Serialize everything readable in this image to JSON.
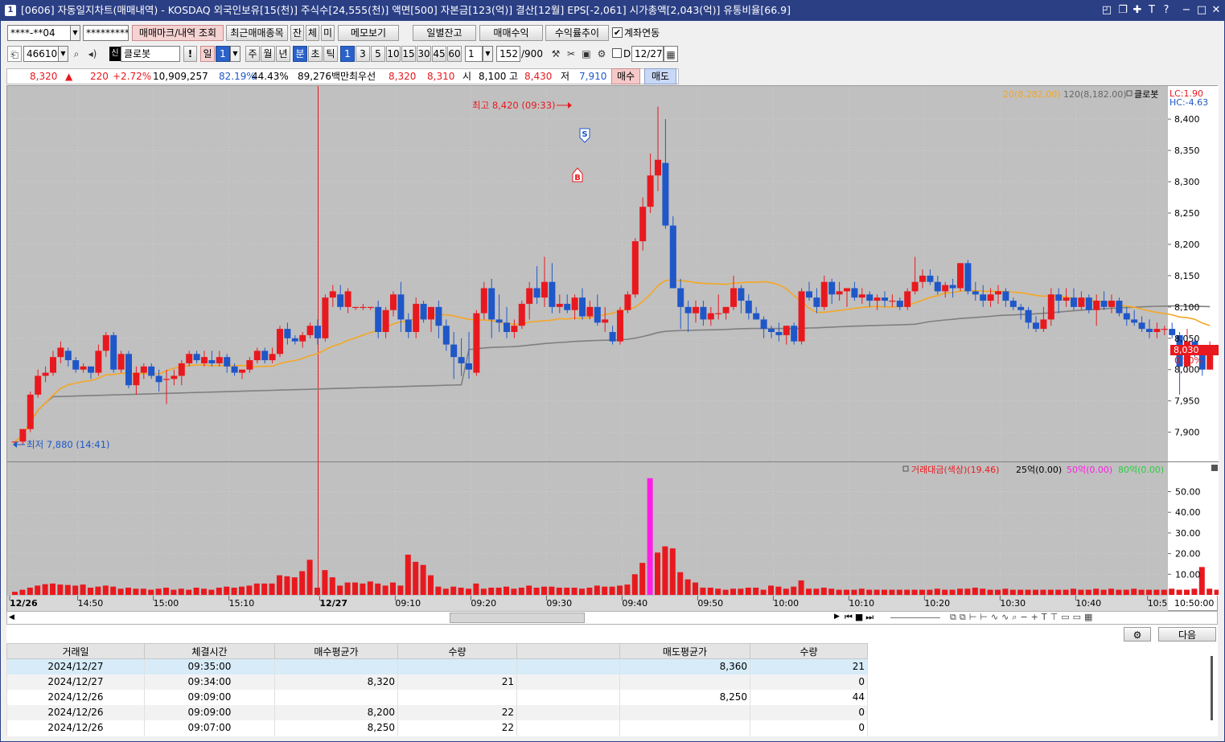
{
  "window": {
    "icon_label": "1",
    "title": "[0606] 자동일지차트(매매내역) - KOSDAQ 외국인보유[15(천)] 주식수[24,555(천)] 액면[500] 자본금[123(억)] 결산[12월] EPS[-2,061] 시가총액[2,043(억)] 유통비율[66.9]"
  },
  "toolbar1": {
    "account": "****-**04",
    "password": "*********",
    "btn_mark": "매매마크/내역 조회",
    "btn_recent": "최근매매종목",
    "btn_jan": "잔",
    "btn_che": "체",
    "btn_mi": "미",
    "btn_memo": "메모보기",
    "btn_daily": "일별잔고",
    "btn_profit": "매매수익",
    "btn_trend": "수익률추이",
    "link_label": "계좌연동",
    "link_checked": true
  },
  "toolbar2": {
    "code": "466100",
    "name": "클로봇",
    "name_badge": "신",
    "periods": [
      "일",
      "1",
      "주",
      "월",
      "년",
      "분",
      "초",
      "틱"
    ],
    "minutes": [
      "1",
      "3",
      "5",
      "10",
      "15",
      "30",
      "45",
      "60"
    ],
    "unit": "1",
    "count": "152",
    "count_max": "/900",
    "d_label": "D",
    "date": "12/27"
  },
  "quote": {
    "price": "8,320",
    "arrow": "▲",
    "change": "220",
    "pct": "+2.72%",
    "volume": "10,909,257",
    "vol_ratio": "82.19%",
    "vol_ratio2": "44.43%",
    "amount": "89,276백만",
    "best_label": "최우선",
    "best_ask": "8,320",
    "best_bid": "8,310",
    "open_label": "시",
    "open": "8,100",
    "high_label": "고",
    "high": "8,430",
    "low_label": "저",
    "low": "7,910",
    "buy_btn": "매수",
    "sell_btn": "매도"
  },
  "chart": {
    "legend_ma20": "20(8,282.00)",
    "legend_ma120": "120(8,182.00)",
    "legend_name": "클로봇",
    "lc": "LC:1.90",
    "hc": "HC:-4.63",
    "price_ticks": [
      "8,400",
      "8,350",
      "8,300",
      "8,250",
      "8,200",
      "8,150",
      "8,100",
      "8,050",
      "8,000",
      "7,950",
      "7,900"
    ],
    "current_price": "8,030",
    "current_pct": "0.50%",
    "high_note": "최고 8,420 (09:33)",
    "low_note": "최저 7,880 (14:41)",
    "marker_s": "S",
    "marker_b": "B",
    "vol_legend": {
      "name": "거래대금(색상)(19.46)",
      "l1": "25억(0.00)",
      "l2": "50억(0.00)",
      "l3": "80억(0.00)"
    },
    "vol_ticks": [
      "50.00",
      "40.00",
      "30.00",
      "20.00",
      "10.00"
    ],
    "time_labels": [
      "12/26",
      "14:50",
      "15:00",
      "15:10",
      "12/27",
      "09:10",
      "09:20",
      "09:30",
      "09:40",
      "09:50",
      "10:00",
      "10:10",
      "10:20",
      "10:30",
      "10:40",
      "10:5"
    ],
    "time_right": "10:50:00",
    "colors": {
      "up": "#e8191e",
      "down": "#1f57c8",
      "ma20": "#f5a623",
      "ma120": "#7f7f7f",
      "highlight": "#ff1ee6"
    }
  },
  "chart_data": {
    "type": "candlestick",
    "title": "",
    "price_axis": {
      "min": 7870,
      "max": 8440
    },
    "volume_axis": {
      "min": 0,
      "max": 58
    },
    "current_price": 8030,
    "candles": [
      [
        7885,
        7885,
        7880,
        7885
      ],
      [
        7885,
        7905,
        7880,
        7905
      ],
      [
        7905,
        7965,
        7900,
        7960
      ],
      [
        7960,
        8000,
        7955,
        7990
      ],
      [
        7990,
        8005,
        7980,
        7995
      ],
      [
        7995,
        8030,
        7990,
        8020
      ],
      [
        8020,
        8045,
        8010,
        8035
      ],
      [
        8030,
        8035,
        8005,
        8015
      ],
      [
        8015,
        8020,
        7995,
        8000
      ],
      [
        8000,
        8010,
        7995,
        8005
      ],
      [
        8005,
        8005,
        7985,
        7995
      ],
      [
        7995,
        8040,
        7990,
        8030
      ],
      [
        8030,
        8060,
        8020,
        8055
      ],
      [
        8055,
        8060,
        7995,
        8000
      ],
      [
        8000,
        8030,
        7995,
        8025
      ],
      [
        8025,
        8030,
        7970,
        7975
      ],
      [
        7975,
        8005,
        7960,
        7995
      ],
      [
        7995,
        8010,
        7985,
        8005
      ],
      [
        8005,
        8010,
        7985,
        7990
      ],
      [
        7990,
        8000,
        7965,
        7980
      ],
      [
        7985,
        8000,
        7945,
        7985
      ],
      [
        7985,
        8000,
        7975,
        7990
      ],
      [
        7990,
        8015,
        7975,
        8010
      ],
      [
        8010,
        8030,
        8005,
        8025
      ],
      [
        8025,
        8030,
        8010,
        8015
      ],
      [
        8010,
        8030,
        8005,
        8020
      ],
      [
        8015,
        8030,
        8005,
        8010
      ],
      [
        8010,
        8030,
        8005,
        8020
      ],
      [
        8020,
        8025,
        7995,
        8005
      ],
      [
        8005,
        8010,
        7990,
        7995
      ],
      [
        7995,
        8000,
        7985,
        8000
      ],
      [
        8000,
        8020,
        7995,
        8015
      ],
      [
        8015,
        8035,
        8010,
        8030
      ],
      [
        8030,
        8035,
        8010,
        8015
      ],
      [
        8015,
        8035,
        8010,
        8025
      ],
      [
        8025,
        8070,
        8020,
        8065
      ],
      [
        8065,
        8075,
        8040,
        8050
      ],
      [
        8050,
        8055,
        8040,
        8045
      ],
      [
        8045,
        8060,
        8035,
        8055
      ],
      [
        8055,
        8075,
        8050,
        8070
      ],
      [
        8070,
        8080,
        8040,
        8050
      ],
      [
        8050,
        8120,
        8045,
        8115
      ],
      [
        8115,
        8135,
        8100,
        8125
      ],
      [
        8120,
        8135,
        8095,
        8100
      ],
      [
        8100,
        8130,
        8090,
        8125
      ],
      [
        8100,
        8100,
        8095,
        8100
      ],
      [
        8100,
        8105,
        8095,
        8100
      ],
      [
        8100,
        8100,
        8095,
        8100
      ],
      [
        8100,
        8110,
        8050,
        8060
      ],
      [
        8060,
        8100,
        8050,
        8095
      ],
      [
        8095,
        8125,
        8085,
        8120
      ],
      [
        8120,
        8140,
        8060,
        8080
      ],
      [
        8080,
        8090,
        8050,
        8060
      ],
      [
        8060,
        8115,
        8050,
        8105
      ],
      [
        8105,
        8110,
        8075,
        8080
      ],
      [
        8080,
        8100,
        8060,
        8100
      ],
      [
        8100,
        8110,
        8050,
        8070
      ],
      [
        8070,
        8080,
        8030,
        8040
      ],
      [
        8040,
        8060,
        7985,
        8020
      ],
      [
        8020,
        8050,
        7990,
        8010
      ],
      [
        8010,
        8060,
        7985,
        8000
      ],
      [
        7995,
        8095,
        7990,
        8090
      ],
      [
        8090,
        8140,
        8080,
        8130
      ],
      [
        8130,
        8145,
        8050,
        8080
      ],
      [
        8080,
        8120,
        8060,
        8075
      ],
      [
        8075,
        8100,
        8050,
        8060
      ],
      [
        8060,
        8080,
        8050,
        8070
      ],
      [
        8070,
        8110,
        8065,
        8105
      ],
      [
        8105,
        8140,
        8080,
        8130
      ],
      [
        8130,
        8165,
        8105,
        8115
      ],
      [
        8115,
        8180,
        8100,
        8140
      ],
      [
        8140,
        8170,
        8090,
        8100
      ],
      [
        8100,
        8120,
        8090,
        8105
      ],
      [
        8105,
        8120,
        8090,
        8095
      ],
      [
        8095,
        8120,
        8080,
        8115
      ],
      [
        8115,
        8130,
        8080,
        8085
      ],
      [
        8085,
        8110,
        8080,
        8100
      ],
      [
        8100,
        8120,
        8070,
        8075
      ],
      [
        8075,
        8100,
        8060,
        8080
      ],
      [
        8060,
        8070,
        8040,
        8045
      ],
      [
        8045,
        8100,
        8040,
        8095
      ],
      [
        8095,
        8125,
        8090,
        8120
      ],
      [
        8120,
        8210,
        8115,
        8205
      ],
      [
        8205,
        8275,
        8190,
        8260
      ],
      [
        8260,
        8345,
        8250,
        8310
      ],
      [
        8310,
        8420,
        8285,
        8335
      ],
      [
        8330,
        8400,
        8225,
        8230
      ],
      [
        8230,
        8245,
        8130,
        8130
      ],
      [
        8130,
        8145,
        8065,
        8100
      ],
      [
        8100,
        8110,
        8060,
        8090
      ],
      [
        8090,
        8110,
        8075,
        8100
      ],
      [
        8100,
        8110,
        8070,
        8080
      ],
      [
        8080,
        8100,
        8070,
        8090
      ],
      [
        8090,
        8120,
        8080,
        8090
      ],
      [
        8090,
        8100,
        8080,
        8100
      ],
      [
        8100,
        8150,
        8095,
        8130
      ],
      [
        8130,
        8135,
        8090,
        8110
      ],
      [
        8110,
        8120,
        8080,
        8090
      ],
      [
        8090,
        8100,
        8080,
        8080
      ],
      [
        8080,
        8085,
        8050,
        8065
      ],
      [
        8065,
        8070,
        8050,
        8060
      ],
      [
        8060,
        8075,
        8045,
        8055
      ],
      [
        8055,
        8070,
        8040,
        8070
      ],
      [
        8070,
        8075,
        8040,
        8045
      ],
      [
        8045,
        8130,
        8040,
        8125
      ],
      [
        8125,
        8140,
        8110,
        8115
      ],
      [
        8115,
        8130,
        8090,
        8100
      ],
      [
        8100,
        8150,
        8095,
        8140
      ],
      [
        8140,
        8145,
        8105,
        8120
      ],
      [
        8120,
        8140,
        8110,
        8125
      ],
      [
        8125,
        8130,
        8100,
        8130
      ],
      [
        8130,
        8140,
        8110,
        8115
      ],
      [
        8115,
        8130,
        8105,
        8120
      ],
      [
        8120,
        8125,
        8100,
        8110
      ],
      [
        8110,
        8120,
        8095,
        8115
      ],
      [
        8115,
        8125,
        8100,
        8110
      ],
      [
        8110,
        8120,
        8100,
        8110
      ],
      [
        8110,
        8115,
        8095,
        8100
      ],
      [
        8100,
        8130,
        8095,
        8125
      ],
      [
        8125,
        8180,
        8120,
        8140
      ],
      [
        8140,
        8160,
        8130,
        8150
      ],
      [
        8150,
        8160,
        8135,
        8140
      ],
      [
        8140,
        8150,
        8120,
        8125
      ],
      [
        8125,
        8140,
        8115,
        8135
      ],
      [
        8135,
        8145,
        8115,
        8130
      ],
      [
        8130,
        8170,
        8125,
        8170
      ],
      [
        8170,
        8175,
        8120,
        8125
      ],
      [
        8125,
        8140,
        8110,
        8120
      ],
      [
        8120,
        8135,
        8100,
        8110
      ],
      [
        8110,
        8130,
        8100,
        8120
      ],
      [
        8120,
        8135,
        8105,
        8125
      ],
      [
        8125,
        8130,
        8100,
        8110
      ],
      [
        8110,
        8115,
        8095,
        8100
      ],
      [
        8100,
        8105,
        8080,
        8095
      ],
      [
        8095,
        8100,
        8065,
        8075
      ],
      [
        8075,
        8085,
        8060,
        8065
      ],
      [
        8065,
        8100,
        8060,
        8080
      ],
      [
        8080,
        8130,
        8070,
        8120
      ],
      [
        8120,
        8130,
        8090,
        8110
      ],
      [
        8110,
        8130,
        8100,
        8115
      ],
      [
        8115,
        8130,
        8095,
        8100
      ],
      [
        8100,
        8125,
        8095,
        8115
      ],
      [
        8115,
        8120,
        8090,
        8095
      ],
      [
        8095,
        8120,
        8070,
        8110
      ],
      [
        8110,
        8125,
        8095,
        8100
      ],
      [
        8100,
        8120,
        8090,
        8110
      ],
      [
        8110,
        8115,
        8085,
        8090
      ],
      [
        8090,
        8100,
        8070,
        8080
      ],
      [
        8080,
        8095,
        8070,
        8075
      ],
      [
        8075,
        8085,
        8060,
        8065
      ],
      [
        8065,
        8080,
        8050,
        8060
      ],
      [
        8060,
        8075,
        8050,
        8065
      ],
      [
        8065,
        8070,
        8055,
        8065
      ],
      [
        8065,
        8075,
        8050,
        8055
      ],
      [
        8055,
        8060,
        7960,
        8005
      ],
      [
        8005,
        8065,
        7995,
        8045
      ],
      [
        8045,
        8050,
        8020,
        8025
      ],
      [
        8025,
        8030,
        7990,
        8000
      ],
      [
        8000,
        8045,
        8000,
        8030
      ]
    ],
    "volumes": [
      1.5,
      2.5,
      3.5,
      4.5,
      5.2,
      5.5,
      5,
      4.8,
      4.5,
      5,
      3.5,
      4,
      4.5,
      4,
      3,
      3.5,
      3,
      3,
      2.5,
      3,
      3.5,
      2.5,
      3,
      2.5,
      3.5,
      3,
      2.5,
      3.5,
      4,
      3.5,
      4,
      4.5,
      5.5,
      5.5,
      5.5,
      9.5,
      9,
      8.5,
      11.5,
      17,
      3.5,
      12,
      8.5,
      4.5,
      6,
      6,
      5.5,
      6.5,
      5.5,
      4.5,
      6,
      4.5,
      19.5,
      16,
      14.5,
      9.5,
      4,
      3,
      4,
      3.5,
      3,
      5.5,
      3,
      3.5,
      3.5,
      4,
      3,
      3.5,
      4.5,
      3.5,
      4,
      4,
      3.5,
      3.5,
      3.5,
      3,
      3.5,
      4.5,
      4,
      4,
      4.5,
      5,
      10,
      15.5,
      56.5,
      20.5,
      23.5,
      22.5,
      11,
      7.5,
      6,
      3.5,
      3.5,
      3,
      2.5,
      3,
      3,
      3.5,
      3.5,
      2.5,
      4.5,
      4,
      3,
      4,
      7,
      3,
      3,
      3.5,
      3,
      2.5,
      2.5,
      2.5,
      3,
      2.5,
      2.5,
      2.5,
      2.5,
      2.5,
      2.5,
      2.5,
      2.5,
      2.5,
      3,
      2.5,
      2.5,
      3,
      3,
      3.5,
      3,
      2.5,
      2.5,
      3,
      2.5,
      2.5,
      2.5,
      2.5,
      2.5,
      2.5,
      2.5,
      2.5,
      3,
      2.5,
      2.5,
      3,
      2.5,
      3,
      2.5,
      2.5,
      3,
      2.5,
      2.5,
      2.5,
      2.5,
      3,
      2.5,
      2.5,
      3,
      13.5,
      3,
      2.5,
      2
    ]
  },
  "scrollbar": {
    "next_btn": "다음"
  },
  "table": {
    "headers": [
      "거래일",
      "체결시간",
      "매수평균가",
      "수량",
      "",
      "매도평균가",
      "수량"
    ],
    "rows": [
      [
        "2024/12/27",
        "09:35:00",
        "",
        "",
        "",
        "8,360",
        "21"
      ],
      [
        "2024/12/27",
        "09:34:00",
        "8,320",
        "21",
        "",
        "",
        "0"
      ],
      [
        "2024/12/26",
        "09:09:00",
        "",
        "",
        "",
        "8,250",
        "44"
      ],
      [
        "2024/12/26",
        "09:09:00",
        "8,200",
        "22",
        "",
        "",
        "0"
      ],
      [
        "2024/12/26",
        "09:07:00",
        "8,250",
        "22",
        "",
        "",
        "0"
      ]
    ]
  }
}
